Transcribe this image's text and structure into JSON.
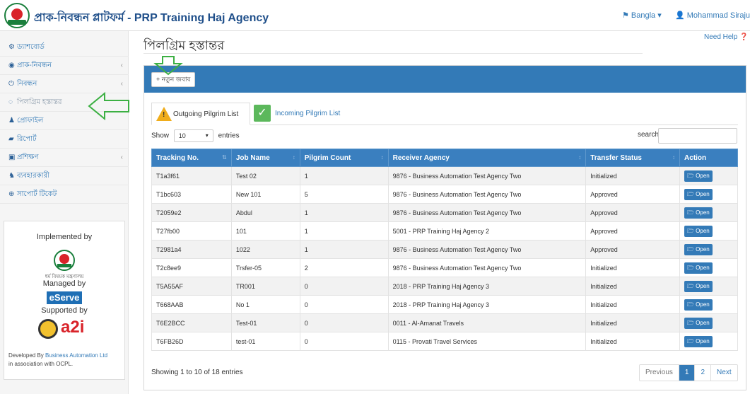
{
  "header": {
    "brand": "প্রাক-নিবন্ধন প্লাটফর্ম - PRP Training Haj Agency",
    "language": "Bangla ▾",
    "user": "Mohammad Sirajul Islam ▾"
  },
  "sidebar": {
    "items": [
      {
        "label": "ড্যাশবোর্ড",
        "icon": "dashboard-icon",
        "glyph": "⚙",
        "chevron": ""
      },
      {
        "label": "প্রাক-নিবন্ধন",
        "icon": "circle-dot-icon",
        "glyph": "◉",
        "chevron": "‹"
      },
      {
        "label": "নিবন্ধন",
        "icon": "power-icon",
        "glyph": "⏻",
        "chevron": "‹"
      },
      {
        "label": "পিলগ্রিম হস্তান্তর",
        "icon": "circle-icon",
        "glyph": "◌",
        "chevron": ""
      },
      {
        "label": "প্রোফাইল",
        "icon": "users-icon",
        "glyph": "♟",
        "chevron": ""
      },
      {
        "label": "রিপোর্ট",
        "icon": "book-icon",
        "glyph": "▰",
        "chevron": ""
      },
      {
        "label": "প্রশিক্ষণ",
        "icon": "file-icon",
        "glyph": "▣",
        "chevron": "‹"
      },
      {
        "label": "ব্যবহারকারী",
        "icon": "group-icon",
        "glyph": "♞",
        "chevron": ""
      },
      {
        "label": "সাপোর্ট টিকেট",
        "icon": "lifebuoy-icon",
        "glyph": "⊕",
        "chevron": ""
      }
    ],
    "footer": {
      "implemented_by": "Implemented by",
      "ministry": "ধর্ম বিষয়ক মন্ত্রণালয়",
      "managed_by": "Managed by",
      "eserve": "eServe",
      "supported_by": "Supported by",
      "a2i": "a2i",
      "developed_by": "Developed By",
      "developer": "Business Automation Ltd",
      "association": "in association with OCPL."
    }
  },
  "main": {
    "need_help": "Need Help ❓",
    "title": "পিলগ্রিম হস্তান্তর",
    "new_button": "+ নতুন জবাব",
    "tabs": {
      "outgoing": "Outgoing Pilgrim List",
      "incoming": "Incoming Pilgrim List"
    },
    "show_label": "Show",
    "entries_value": "10",
    "entries_label": "entries",
    "search_label": "search:",
    "columns": [
      "Tracking No.",
      "Job Name",
      "Pilgrim Count",
      "Receiver Agency",
      "Transfer Status",
      "Action"
    ],
    "rows": [
      [
        "T1a3f61",
        "Test 02",
        "1",
        "9876 - Business Automation Test Agency Two",
        "Initialized"
      ],
      [
        "T1bc603",
        "New 101",
        "5",
        "9876 - Business Automation Test Agency Two",
        "Approved"
      ],
      [
        "T2059e2",
        "Abdul",
        "1",
        "9876 - Business Automation Test Agency Two",
        "Approved"
      ],
      [
        "T27fb00",
        "101",
        "1",
        "5001 - PRP Training Haj Agency 2",
        "Approved"
      ],
      [
        "T2981a4",
        "1022",
        "1",
        "9876 - Business Automation Test Agency Two",
        "Approved"
      ],
      [
        "T2c8ee9",
        "Trsfer-05",
        "2",
        "9876 - Business Automation Test Agency Two",
        "Initialized"
      ],
      [
        "T5A55AF",
        "TR001",
        "0",
        "2018 - PRP Training Haj Agency 3",
        "Initialized"
      ],
      [
        "T668AAB",
        "No 1",
        "0",
        "2018 - PRP Training Haj Agency 3",
        "Initialized"
      ],
      [
        "T6E2BCC",
        "Test-01",
        "0",
        "0011 - Al-Amanat Travels",
        "Initialized"
      ],
      [
        "T6FB26D",
        "test-01",
        "0",
        "0115 - Provati Travel Services",
        "Initialized"
      ]
    ],
    "open_label": "🗁 Open",
    "info": "Showing 1 to 10 of 18 entries",
    "pagination": {
      "previous": "Previous",
      "pages": [
        "1",
        "2"
      ],
      "next": "Next"
    }
  },
  "colors": {
    "primary": "#337ab7",
    "header_row": "#3a7fbf",
    "arrow": "#3cb043"
  }
}
